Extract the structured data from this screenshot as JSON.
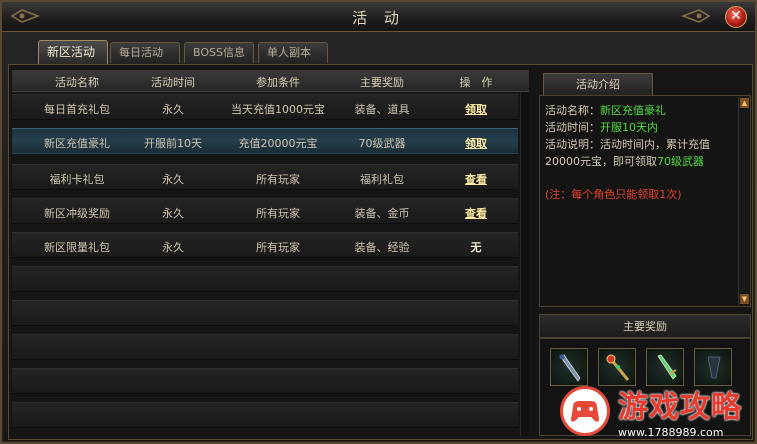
{
  "window": {
    "title": "活 动",
    "close_icon": "close-icon"
  },
  "tabs": [
    {
      "label": "新区活动",
      "active": true
    },
    {
      "label": "每日活动",
      "active": false
    },
    {
      "label": "BOSS信息",
      "active": false
    },
    {
      "label": "单人副本",
      "active": false
    }
  ],
  "table": {
    "headers": [
      "活动名称",
      "活动时间",
      "参加条件",
      "主要奖励",
      "操　作"
    ],
    "rows": [
      {
        "name": "每日首充礼包",
        "time": "永久",
        "condition": "当天充值1000元宝",
        "reward": "装备、道具",
        "action": "领取"
      },
      {
        "name": "新区充值豪礼",
        "time": "开服前10天",
        "condition": "充值20000元宝",
        "reward": "70级武器",
        "action": "领取"
      },
      {
        "name": "福利卡礼包",
        "time": "永久",
        "condition": "所有玩家",
        "reward": "福利礼包",
        "action": "查看"
      },
      {
        "name": "新区冲级奖励",
        "time": "永久",
        "condition": "所有玩家",
        "reward": "装备、金币",
        "action": "查看"
      },
      {
        "name": "新区限量礼包",
        "time": "永久",
        "condition": "所有玩家",
        "reward": "装备、经验",
        "action": "无"
      }
    ]
  },
  "intro": {
    "header": "活动介绍",
    "line1_label": "活动名称：",
    "line1_value": "新区充值豪礼",
    "line2_label": "活动时间：",
    "line2_value": "开服10天内",
    "line3": "活动说明：活动时间内，累计充值",
    "line4_prefix": "20000元宝，即可领取",
    "line4_value": "70级武器",
    "note": "(注：每个角色只能领取1次)"
  },
  "rewards": {
    "header": "主要奖励",
    "items": [
      "dark-spear-icon",
      "jeweled-staff-icon",
      "green-sword-icon",
      "shadow-blade-icon"
    ]
  },
  "watermark": {
    "text": "游戏攻略",
    "url": "www.1788989.com"
  },
  "colors": {
    "highlight": "#55dd44",
    "note": "#e8402d",
    "border": "#6a5838",
    "selected_row": "#243e4b"
  }
}
